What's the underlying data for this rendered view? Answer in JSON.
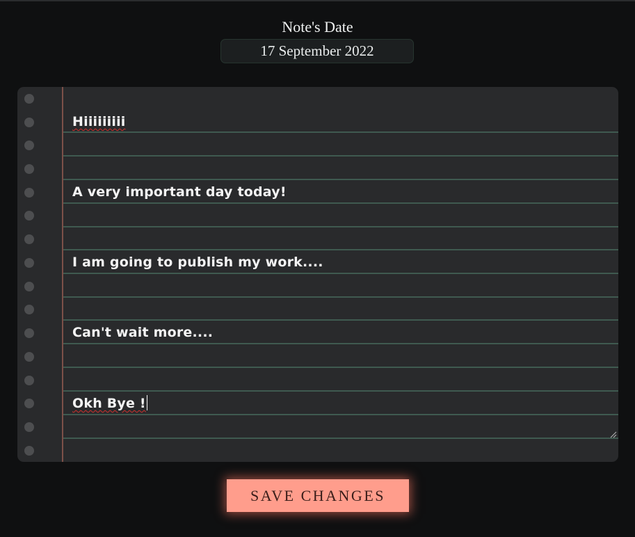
{
  "header": {
    "date_label": "Note's Date",
    "date_value": "17 September 2022"
  },
  "note": {
    "lines": [
      "Hiiiiiiiii",
      "A very important day today!",
      "I am going to publish my work....",
      "Can't wait more....",
      "Okh Bye !"
    ]
  },
  "actions": {
    "save_label": "SAVE CHANGES"
  },
  "colors": {
    "background": "#0f1011",
    "paper": "#292a2c",
    "ruled_line": "#3f5a50",
    "margin_line": "#7c5048",
    "button": "#ff9d8c",
    "spellcheck": "#d0312d"
  }
}
